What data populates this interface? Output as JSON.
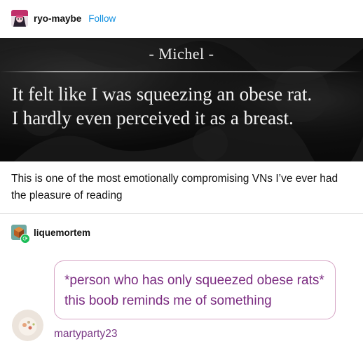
{
  "post": {
    "username": "ryo-maybe",
    "follow_label": "Follow",
    "image": {
      "speaker": "- Michel -",
      "lines": [
        "It felt like I was squeezing an obese rat.",
        "I hardly even perceived it as a breast."
      ]
    },
    "caption": "This is one of the most emotionally compromising VNs I’ve ever had the pleasure of reading"
  },
  "reblog": {
    "username": "liquemortem",
    "badge_icon": "reblog-icon"
  },
  "comment": {
    "text": "*person who has only squeezed obese rats* this boob reminds me of something",
    "author": "martyparty23",
    "accent_color": "#7a2a80"
  }
}
